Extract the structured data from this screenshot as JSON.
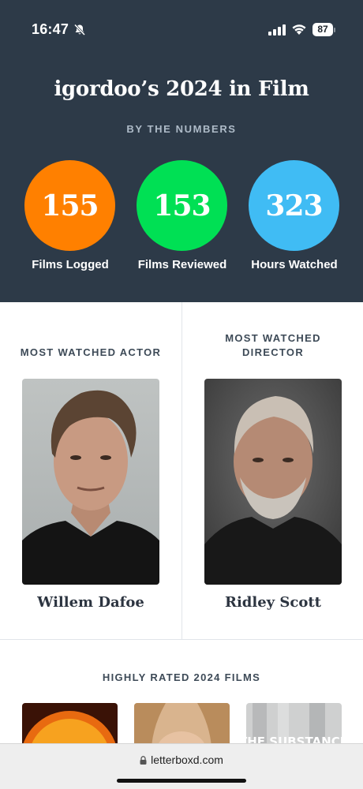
{
  "status_bar": {
    "time": "16:47",
    "battery": "87"
  },
  "header": {
    "title": "igordoo’s 2024 in Film",
    "subtitle": "BY THE NUMBERS"
  },
  "stats": [
    {
      "value": "155",
      "label": "Films Logged",
      "color": "#ff8000"
    },
    {
      "value": "153",
      "label": "Films Reviewed",
      "color": "#00e054"
    },
    {
      "value": "323",
      "label": "Hours Watched",
      "color": "#40bcf4"
    }
  ],
  "people": {
    "actor": {
      "heading": "MOST WATCHED ACTOR",
      "name": "Willem Dafoe"
    },
    "director": {
      "heading_line1": "MOST WATCHED",
      "heading_line2": "DIRECTOR",
      "name": "Ridley Scott"
    }
  },
  "rated": {
    "heading": "HIGHLY RATED 2024 FILMS",
    "poster_3_text": "THE SUBSTANCE"
  },
  "browser": {
    "url": "letterboxd.com"
  },
  "colors": {
    "hero_bg": "#2d3a48",
    "text_muted": "#aebbc8"
  },
  "icons": [
    "bell-slash-icon",
    "cellular-signal-icon",
    "wifi-icon",
    "battery-icon",
    "lock-icon"
  ]
}
